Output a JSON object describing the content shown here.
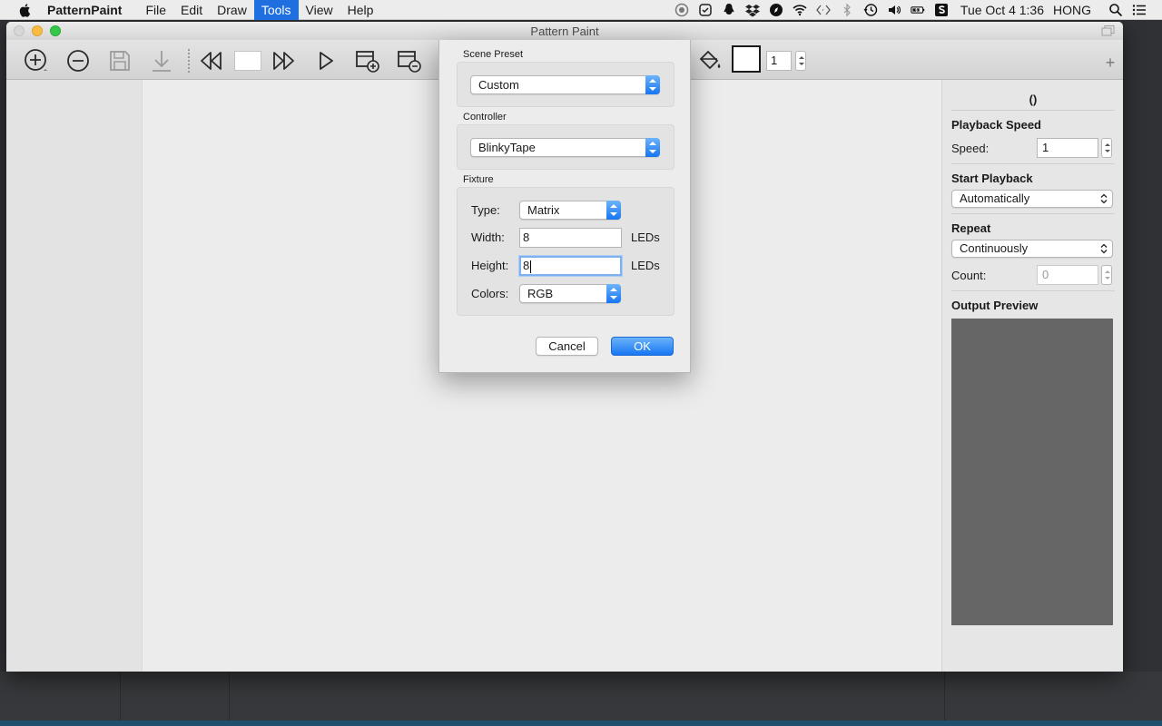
{
  "menubar": {
    "app_name": "PatternPaint",
    "menus": [
      "File",
      "Edit",
      "Draw",
      "Tools",
      "View",
      "Help"
    ],
    "active_menu": "Tools",
    "clock": "Tue Oct 4  1:36",
    "user": "HONG"
  },
  "window": {
    "title": "Pattern Paint",
    "frame_index": "1"
  },
  "right_panel": {
    "title": "()",
    "playback_speed_heading": "Playback Speed",
    "speed_label": "Speed:",
    "speed_value": "1",
    "start_playback_heading": "Start Playback",
    "start_playback_value": "Automatically",
    "repeat_heading": "Repeat",
    "repeat_value": "Continuously",
    "count_label": "Count:",
    "count_value": "0",
    "output_preview_heading": "Output Preview"
  },
  "dialog": {
    "scene_preset_label": "Scene Preset",
    "scene_preset_value": "Custom",
    "controller_label": "Controller",
    "controller_value": "BlinkyTape",
    "fixture_label": "Fixture",
    "type_label": "Type:",
    "type_value": "Matrix",
    "width_label": "Width:",
    "width_value": "8",
    "width_unit": "LEDs",
    "height_label": "Height:",
    "height_value": "8",
    "height_unit": "LEDs",
    "colors_label": "Colors:",
    "colors_value": "RGB",
    "cancel_label": "Cancel",
    "ok_label": "OK"
  },
  "colors": {
    "accent": "#1f6fe0",
    "preview_bg": "#666666"
  }
}
